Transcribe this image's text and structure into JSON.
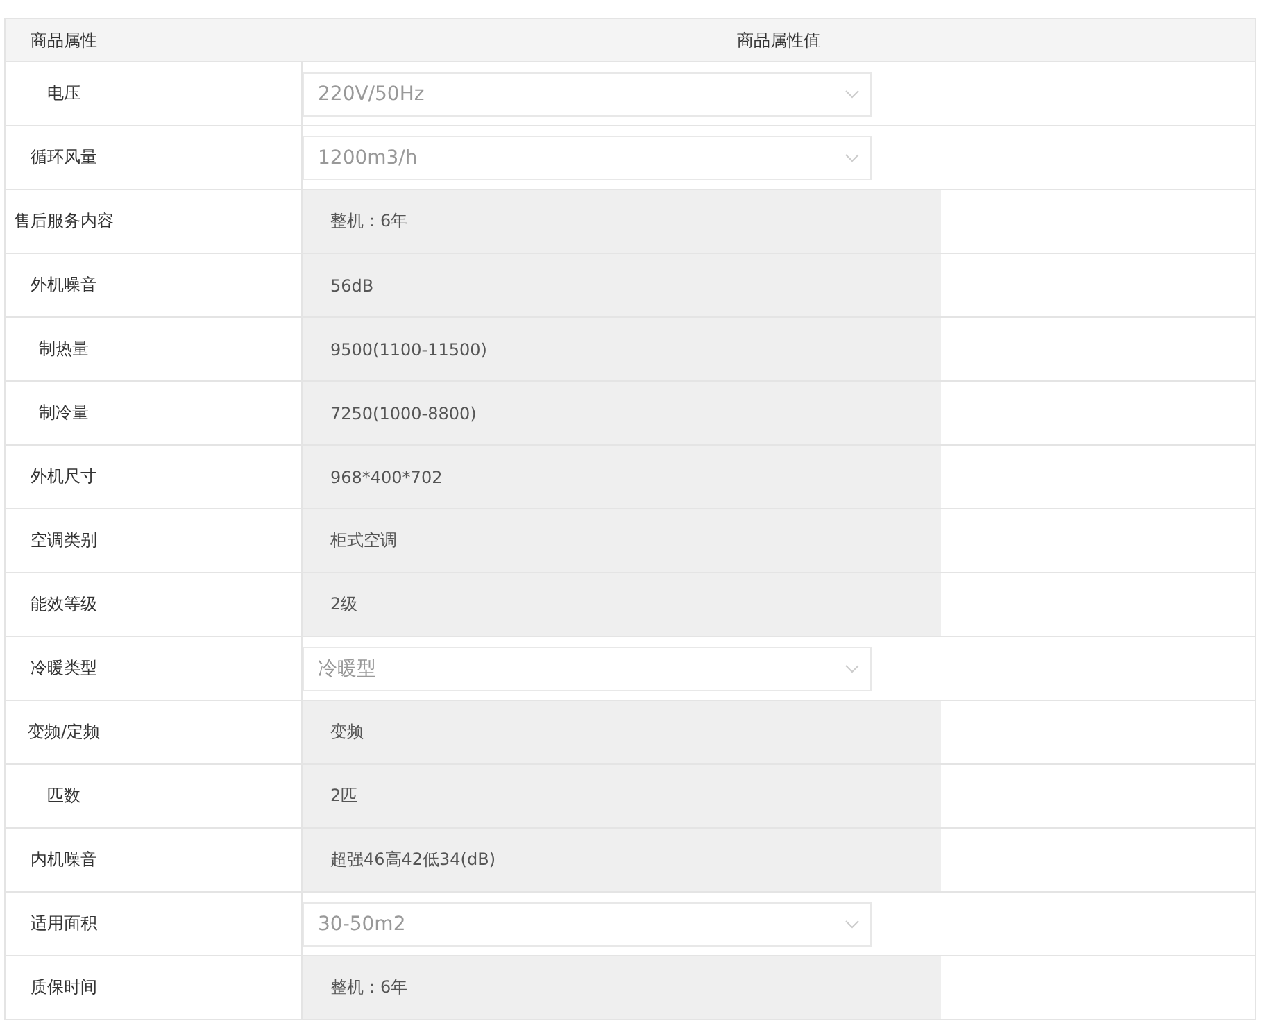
{
  "table": {
    "columns": [
      "商品属性",
      "商品属性值"
    ],
    "rows": [
      {
        "name": "电压",
        "kind": "select",
        "value": "220V/50Hz"
      },
      {
        "name": "循环风量",
        "kind": "select",
        "value": "1200m3/h"
      },
      {
        "name": "售后服务内容",
        "kind": "text",
        "value": "整机：6年"
      },
      {
        "name": "外机噪音",
        "kind": "text",
        "value": "56dB"
      },
      {
        "name": "制热量",
        "kind": "text",
        "value": "9500(1100-11500)"
      },
      {
        "name": "制冷量",
        "kind": "text",
        "value": "7250(1000-8800)"
      },
      {
        "name": "外机尺寸",
        "kind": "text",
        "value": "968*400*702"
      },
      {
        "name": "空调类别",
        "kind": "text",
        "value": "柜式空调"
      },
      {
        "name": "能效等级",
        "kind": "text",
        "value": "2级"
      },
      {
        "name": "冷暖类型",
        "kind": "select",
        "value": "冷暖型"
      },
      {
        "name": "变频/定频",
        "kind": "text",
        "value": "变频"
      },
      {
        "name": "匹数",
        "kind": "text",
        "value": "2匹"
      },
      {
        "name": "内机噪音",
        "kind": "text",
        "value": "超强46高42低34(dB)"
      },
      {
        "name": "适用面积",
        "kind": "select",
        "value": "30-50m2"
      },
      {
        "name": "质保时间",
        "kind": "text",
        "value": "整机：6年"
      }
    ]
  }
}
